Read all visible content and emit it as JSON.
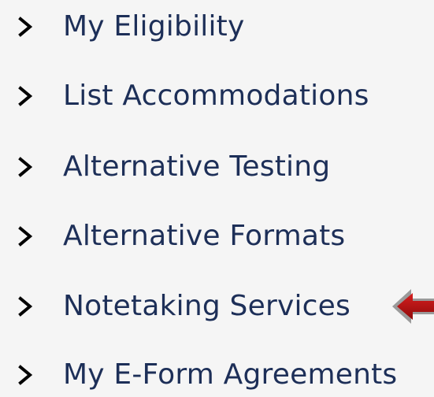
{
  "menu": {
    "items": [
      {
        "label": "My Eligibility",
        "icon": "chevron-right-icon"
      },
      {
        "label": "List Accommodations",
        "icon": "chevron-right-icon"
      },
      {
        "label": "Alternative Testing",
        "icon": "chevron-right-icon"
      },
      {
        "label": "Alternative Formats",
        "icon": "chevron-right-icon"
      },
      {
        "label": "Notetaking Services",
        "icon": "chevron-right-icon"
      },
      {
        "label": "My E-Form Agreements",
        "icon": "chevron-right-icon"
      }
    ]
  },
  "annotation": {
    "icon": "red-arrow-left-icon",
    "color": "#b50f0f"
  },
  "colors": {
    "text": "#1d2f58",
    "background": "#f5f5f5"
  }
}
